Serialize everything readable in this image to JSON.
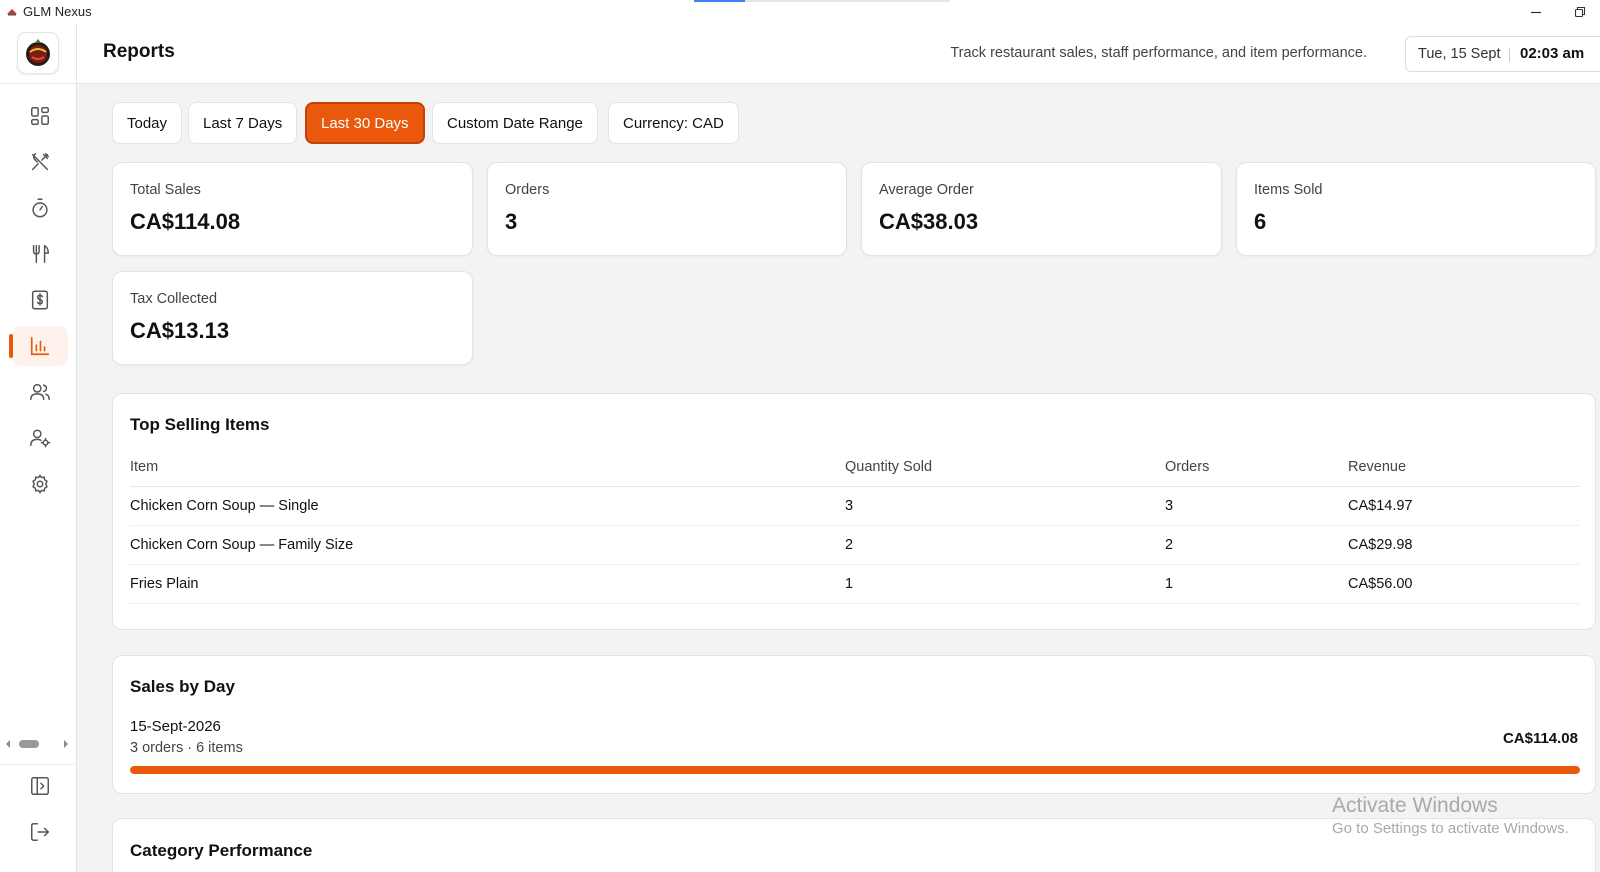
{
  "window": {
    "title": "GLM Nexus",
    "progress": 0.2,
    "minimize_icon": "minimize-icon",
    "restore_icon": "restore-icon"
  },
  "sidebar": {
    "logo_icon": "restaurant-logo",
    "items": [
      {
        "name": "dashboard",
        "icon": "grid-icon",
        "active": false
      },
      {
        "name": "menu",
        "icon": "utensils-crossed-icon",
        "active": false
      },
      {
        "name": "timer",
        "icon": "stopwatch-icon",
        "active": false
      },
      {
        "name": "dining",
        "icon": "fork-knife-icon",
        "active": false
      },
      {
        "name": "billing",
        "icon": "receipt-dollar-icon",
        "active": false
      },
      {
        "name": "reports",
        "icon": "bar-chart-icon",
        "active": true
      },
      {
        "name": "staff",
        "icon": "users-icon",
        "active": false
      },
      {
        "name": "user-settings",
        "icon": "user-gear-icon",
        "active": false
      },
      {
        "name": "settings",
        "icon": "gear-icon",
        "active": false
      }
    ],
    "bottom_items": [
      {
        "name": "toggle-sidebar",
        "icon": "panel-expand-icon"
      },
      {
        "name": "logout",
        "icon": "logout-icon"
      }
    ],
    "accent_color": "#ea580c"
  },
  "header": {
    "title": "Reports",
    "subtitle": "Track restaurant sales, staff performance, and item performance.",
    "date": "Tue, 15 Sept",
    "time": "02:03 am"
  },
  "range_buttons": [
    {
      "label": "Today",
      "active": false
    },
    {
      "label": "Last 7 Days",
      "active": false
    },
    {
      "label": "Last 30 Days",
      "active": true
    },
    {
      "label": "Custom Date Range",
      "active": false
    },
    {
      "label": "Currency: CAD",
      "active": false
    }
  ],
  "stats": [
    {
      "label": "Total Sales",
      "value": "CA$114.08"
    },
    {
      "label": "Orders",
      "value": "3"
    },
    {
      "label": "Average Order",
      "value": "CA$38.03"
    },
    {
      "label": "Items Sold",
      "value": "6"
    },
    {
      "label": "Tax Collected",
      "value": "CA$13.13"
    }
  ],
  "top_selling": {
    "title": "Top Selling Items",
    "columns": [
      "Item",
      "Quantity Sold",
      "Orders",
      "Revenue"
    ],
    "rows": [
      {
        "item": "Chicken Corn Soup — Single",
        "qty": "3",
        "orders": "3",
        "revenue": "CA$14.97"
      },
      {
        "item": "Chicken Corn Soup — Family Size",
        "qty": "2",
        "orders": "2",
        "revenue": "CA$29.98"
      },
      {
        "item": "Fries Plain",
        "qty": "1",
        "orders": "1",
        "revenue": "CA$56.00"
      }
    ]
  },
  "sales_by_day": {
    "title": "Sales by Day",
    "days": [
      {
        "date": "15-Sept-2026",
        "meta": "3 orders · 6 items",
        "total": "CA$114.08",
        "share": 1.0
      }
    ]
  },
  "category_performance": {
    "title": "Category Performance"
  },
  "watermark": {
    "title": "Activate Windows",
    "subtitle": "Go to Settings to activate Windows."
  }
}
